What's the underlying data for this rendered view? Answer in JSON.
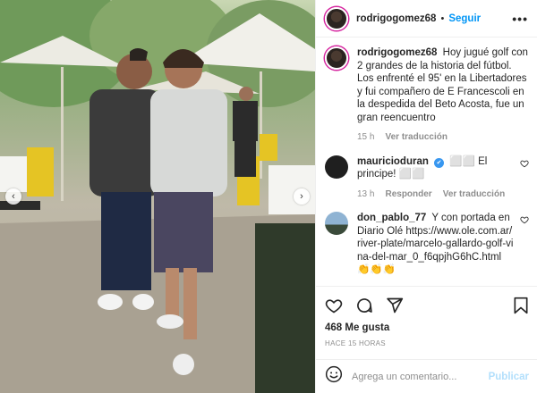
{
  "header": {
    "username": "rodrigogomez68",
    "separator": "•",
    "follow_label": "Seguir",
    "more_label": "•••"
  },
  "caption": {
    "username": "rodrigogomez68",
    "text": "Hoy jugué golf con 2 grandes de la historia del fútbol. Los enfrenté el 95' en la Libertadores y fui compañero de E Francescoli en la despedida del Beto Acosta, fue un gran reencuentro",
    "time": "15 h",
    "translate_label": "Ver traducción"
  },
  "comments": [
    {
      "username": "mauricioduran",
      "verified": "✔",
      "text": "⬜⬜ El principe! ⬜⬜",
      "time": "13 h",
      "reply_label": "Responder",
      "translate_label": "Ver traducción",
      "avatar_color": "#1f1f1f"
    },
    {
      "username": "don_pablo_77",
      "text": "Y con portada en Diario Olé https://www.ole.com.ar/river-plate/marcelo-gallardo-golf-vina-del-mar_0_f6qpjhG6hC.html 👏👏👏",
      "avatar_color": "#6b8fb0"
    }
  ],
  "actions": {
    "like_icon": "heart-icon",
    "comment_icon": "comment-icon",
    "share_icon": "share-icon",
    "save_icon": "bookmark-icon"
  },
  "likes_text": "468 Me gusta",
  "post_time": "HACE 15 HORAS",
  "add_comment": {
    "placeholder": "Agrega un comentario...",
    "publish_label": "Publicar",
    "emoji_icon": "emoji-icon"
  },
  "photo": {
    "prev_arrow": "‹",
    "next_arrow": "›"
  },
  "colors": {
    "accent": "#0095f6",
    "publish_disabled": "#b2dffc",
    "secondary_text": "#8e8e8e"
  }
}
